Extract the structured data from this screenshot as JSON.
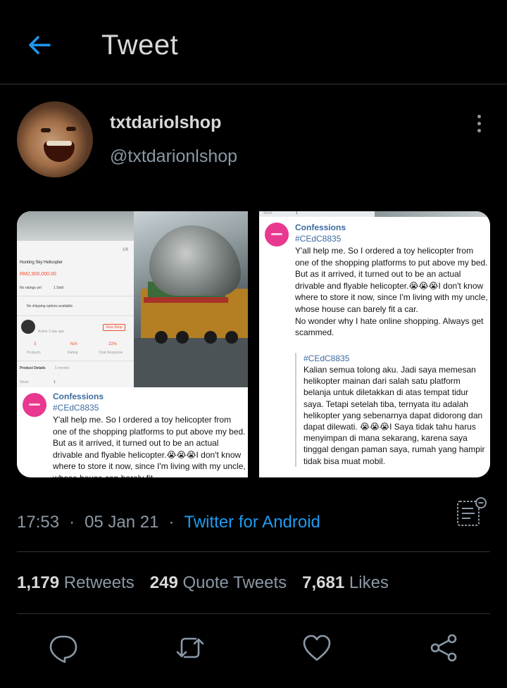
{
  "header": {
    "title": "Tweet"
  },
  "author": {
    "display_name": "txtdariolshop",
    "handle": "@txtdarionlshop"
  },
  "media": {
    "left": {
      "shop_screenshot": {
        "page": "1/6",
        "product": "Hunting Sky Helicopter",
        "price": "RM2,900,000.00",
        "ratings": "No ratings yet",
        "sold": "1 Sold",
        "shipping": "No shipping options available",
        "active": "Active 1 day ago",
        "view_shop": "View Shop",
        "stat_products": "3",
        "stat_products_label": "Products",
        "stat_rating": "N/A",
        "stat_rating_label": "Rating",
        "stat_chat": "22%",
        "stat_chat_label": "Chat Response",
        "details": "Product Details",
        "details_time": "5 months",
        "stock_label": "Stock",
        "stock_value": "1"
      },
      "confession": {
        "name": "Confessions",
        "tag": "#CEdC8835",
        "text": "Y'all help me. So I ordered a toy helicopter from one of the shopping platforms to put above my bed. But as it arrived, it turned out to be an actual drivable and flyable helicopter.😭😭😭I don't know where to store it now, since I'm living with my uncle, whose house can barely fit"
      }
    },
    "right": {
      "stock_label": "Stock",
      "stock_value": "1",
      "confession": {
        "name": "Confessions",
        "tag": "#CEdC8835",
        "text1": "Y'all help me. So I ordered a toy helicopter from one of the shopping platforms to put above my bed. But as it arrived, it turned out to be an actual drivable and flyable helicopter.😭😭😭I don't know where to store it now, since I'm living with my uncle, whose house can barely fit a car.",
        "text2": "No wonder why I hate online shopping. Always get scammed.",
        "quote_tag": "#CEdC8835",
        "quote_text": "Kalian semua tolong aku. Jadi saya memesan helikopter mainan dari salah satu platform belanja untuk diletakkan di atas tempat tidur saya. Tetapi setelah tiba, ternyata itu adalah helikopter yang sebenarnya dapat didorong dan dapat dilewati. 😭😭😭I Saya tidak tahu harus menyimpan di mana sekarang, karena saya tinggal dengan paman saya, rumah yang hampir tidak bisa muat mobil."
      }
    }
  },
  "meta": {
    "time": "17:53",
    "date": "05 Jan 21",
    "source": "Twitter for Android"
  },
  "stats": {
    "retweets_count": "1,179",
    "retweets_label": "Retweets",
    "quotes_count": "249",
    "quotes_label": "Quote Tweets",
    "likes_count": "7,681",
    "likes_label": "Likes"
  },
  "colors": {
    "background": "#000000",
    "accent": "#1d9bf0",
    "muted": "#8b98a5",
    "divider": "#2f3336"
  },
  "icons": [
    "back-arrow-icon",
    "more-icon",
    "analytics-icon",
    "reply-icon",
    "retweet-icon",
    "like-icon",
    "share-icon"
  ]
}
